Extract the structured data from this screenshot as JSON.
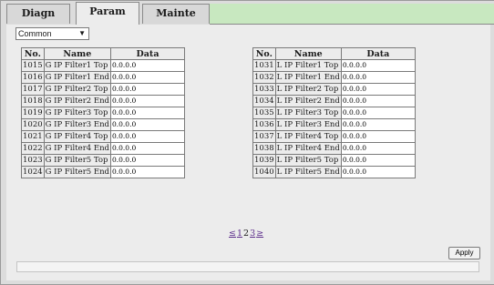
{
  "tabs": [
    {
      "label": "Diagn",
      "active": false
    },
    {
      "label": "Param",
      "active": true
    },
    {
      "label": "Mainte",
      "active": false
    }
  ],
  "group_select": {
    "value": "Common"
  },
  "columns": {
    "no": "No.",
    "name": "Name",
    "data": "Data"
  },
  "left_table": [
    {
      "no": "1015",
      "name": "G IP Filter1 Top",
      "data": "0.0.0.0"
    },
    {
      "no": "1016",
      "name": "G IP Filter1 End",
      "data": "0.0.0.0"
    },
    {
      "no": "1017",
      "name": "G IP Filter2 Top",
      "data": "0.0.0.0"
    },
    {
      "no": "1018",
      "name": "G IP Filter2 End",
      "data": "0.0.0.0"
    },
    {
      "no": "1019",
      "name": "G IP Filter3 Top",
      "data": "0.0.0.0"
    },
    {
      "no": "1020",
      "name": "G IP Filter3 End",
      "data": "0.0.0.0"
    },
    {
      "no": "1021",
      "name": "G IP Filter4 Top",
      "data": "0.0.0.0"
    },
    {
      "no": "1022",
      "name": "G IP Filter4 End",
      "data": "0.0.0.0"
    },
    {
      "no": "1023",
      "name": "G IP Filter5 Top",
      "data": "0.0.0.0"
    },
    {
      "no": "1024",
      "name": "G IP Filter5 End",
      "data": "0.0.0.0"
    }
  ],
  "right_table": [
    {
      "no": "1031",
      "name": "L IP Filter1 Top",
      "data": "0.0.0.0"
    },
    {
      "no": "1032",
      "name": "L IP Filter1 End",
      "data": "0.0.0.0"
    },
    {
      "no": "1033",
      "name": "L IP Filter2 Top",
      "data": "0.0.0.0"
    },
    {
      "no": "1034",
      "name": "L IP Filter2 End",
      "data": "0.0.0.0"
    },
    {
      "no": "1035",
      "name": "L IP Filter3 Top",
      "data": "0.0.0.0"
    },
    {
      "no": "1036",
      "name": "L IP Filter3 End",
      "data": "0.0.0.0"
    },
    {
      "no": "1037",
      "name": "L IP Filter4 Top",
      "data": "0.0.0.0"
    },
    {
      "no": "1038",
      "name": "L IP Filter4 End",
      "data": "0.0.0.0"
    },
    {
      "no": "1039",
      "name": "L IP Filter5 Top",
      "data": "0.0.0.0"
    },
    {
      "no": "1040",
      "name": "L IP Filter5 End",
      "data": "0.0.0.0"
    }
  ],
  "pager": {
    "prev": "≤",
    "pages": [
      "1",
      "2",
      "3"
    ],
    "current": "2",
    "next": "≥"
  },
  "apply_label": "Apply",
  "colors": {
    "tab_fill": "#c8e8c0",
    "panel": "#ececec",
    "link": "#5a2a8a"
  }
}
